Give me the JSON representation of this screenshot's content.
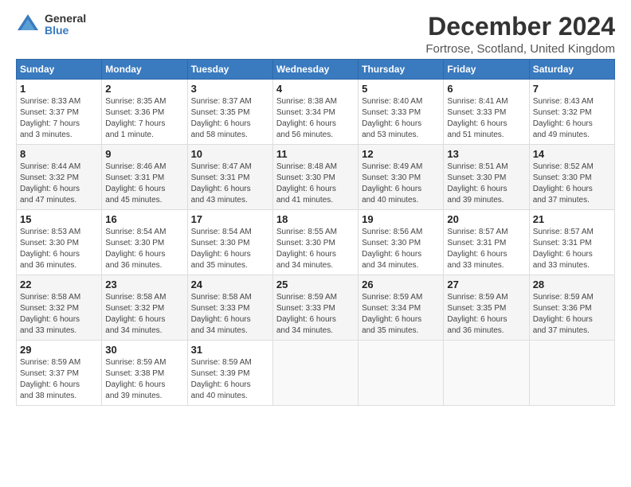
{
  "logo": {
    "general": "General",
    "blue": "Blue"
  },
  "title": "December 2024",
  "subtitle": "Fortrose, Scotland, United Kingdom",
  "headers": [
    "Sunday",
    "Monday",
    "Tuesday",
    "Wednesday",
    "Thursday",
    "Friday",
    "Saturday"
  ],
  "weeks": [
    [
      {
        "day": "1",
        "info": "Sunrise: 8:33 AM\nSunset: 3:37 PM\nDaylight: 7 hours\nand 3 minutes."
      },
      {
        "day": "2",
        "info": "Sunrise: 8:35 AM\nSunset: 3:36 PM\nDaylight: 7 hours\nand 1 minute."
      },
      {
        "day": "3",
        "info": "Sunrise: 8:37 AM\nSunset: 3:35 PM\nDaylight: 6 hours\nand 58 minutes."
      },
      {
        "day": "4",
        "info": "Sunrise: 8:38 AM\nSunset: 3:34 PM\nDaylight: 6 hours\nand 56 minutes."
      },
      {
        "day": "5",
        "info": "Sunrise: 8:40 AM\nSunset: 3:33 PM\nDaylight: 6 hours\nand 53 minutes."
      },
      {
        "day": "6",
        "info": "Sunrise: 8:41 AM\nSunset: 3:33 PM\nDaylight: 6 hours\nand 51 minutes."
      },
      {
        "day": "7",
        "info": "Sunrise: 8:43 AM\nSunset: 3:32 PM\nDaylight: 6 hours\nand 49 minutes."
      }
    ],
    [
      {
        "day": "8",
        "info": "Sunrise: 8:44 AM\nSunset: 3:32 PM\nDaylight: 6 hours\nand 47 minutes."
      },
      {
        "day": "9",
        "info": "Sunrise: 8:46 AM\nSunset: 3:31 PM\nDaylight: 6 hours\nand 45 minutes."
      },
      {
        "day": "10",
        "info": "Sunrise: 8:47 AM\nSunset: 3:31 PM\nDaylight: 6 hours\nand 43 minutes."
      },
      {
        "day": "11",
        "info": "Sunrise: 8:48 AM\nSunset: 3:30 PM\nDaylight: 6 hours\nand 41 minutes."
      },
      {
        "day": "12",
        "info": "Sunrise: 8:49 AM\nSunset: 3:30 PM\nDaylight: 6 hours\nand 40 minutes."
      },
      {
        "day": "13",
        "info": "Sunrise: 8:51 AM\nSunset: 3:30 PM\nDaylight: 6 hours\nand 39 minutes."
      },
      {
        "day": "14",
        "info": "Sunrise: 8:52 AM\nSunset: 3:30 PM\nDaylight: 6 hours\nand 37 minutes."
      }
    ],
    [
      {
        "day": "15",
        "info": "Sunrise: 8:53 AM\nSunset: 3:30 PM\nDaylight: 6 hours\nand 36 minutes."
      },
      {
        "day": "16",
        "info": "Sunrise: 8:54 AM\nSunset: 3:30 PM\nDaylight: 6 hours\nand 36 minutes."
      },
      {
        "day": "17",
        "info": "Sunrise: 8:54 AM\nSunset: 3:30 PM\nDaylight: 6 hours\nand 35 minutes."
      },
      {
        "day": "18",
        "info": "Sunrise: 8:55 AM\nSunset: 3:30 PM\nDaylight: 6 hours\nand 34 minutes."
      },
      {
        "day": "19",
        "info": "Sunrise: 8:56 AM\nSunset: 3:30 PM\nDaylight: 6 hours\nand 34 minutes."
      },
      {
        "day": "20",
        "info": "Sunrise: 8:57 AM\nSunset: 3:31 PM\nDaylight: 6 hours\nand 33 minutes."
      },
      {
        "day": "21",
        "info": "Sunrise: 8:57 AM\nSunset: 3:31 PM\nDaylight: 6 hours\nand 33 minutes."
      }
    ],
    [
      {
        "day": "22",
        "info": "Sunrise: 8:58 AM\nSunset: 3:32 PM\nDaylight: 6 hours\nand 33 minutes."
      },
      {
        "day": "23",
        "info": "Sunrise: 8:58 AM\nSunset: 3:32 PM\nDaylight: 6 hours\nand 34 minutes."
      },
      {
        "day": "24",
        "info": "Sunrise: 8:58 AM\nSunset: 3:33 PM\nDaylight: 6 hours\nand 34 minutes."
      },
      {
        "day": "25",
        "info": "Sunrise: 8:59 AM\nSunset: 3:33 PM\nDaylight: 6 hours\nand 34 minutes."
      },
      {
        "day": "26",
        "info": "Sunrise: 8:59 AM\nSunset: 3:34 PM\nDaylight: 6 hours\nand 35 minutes."
      },
      {
        "day": "27",
        "info": "Sunrise: 8:59 AM\nSunset: 3:35 PM\nDaylight: 6 hours\nand 36 minutes."
      },
      {
        "day": "28",
        "info": "Sunrise: 8:59 AM\nSunset: 3:36 PM\nDaylight: 6 hours\nand 37 minutes."
      }
    ],
    [
      {
        "day": "29",
        "info": "Sunrise: 8:59 AM\nSunset: 3:37 PM\nDaylight: 6 hours\nand 38 minutes."
      },
      {
        "day": "30",
        "info": "Sunrise: 8:59 AM\nSunset: 3:38 PM\nDaylight: 6 hours\nand 39 minutes."
      },
      {
        "day": "31",
        "info": "Sunrise: 8:59 AM\nSunset: 3:39 PM\nDaylight: 6 hours\nand 40 minutes."
      },
      null,
      null,
      null,
      null
    ]
  ]
}
